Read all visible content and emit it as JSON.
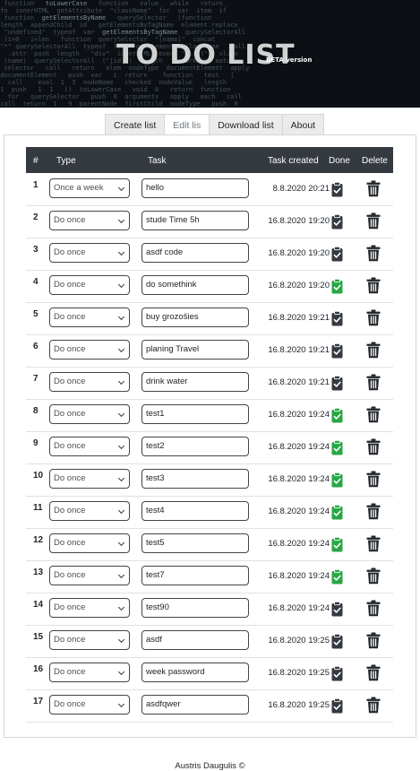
{
  "banner": {
    "title": "TO DO LIST",
    "badge": "BETA version"
  },
  "tabs": [
    {
      "label": "Create list",
      "active": false
    },
    {
      "label": "Edit lis",
      "active": true
    },
    {
      "label": "Download list",
      "active": false
    },
    {
      "label": "About",
      "active": false
    }
  ],
  "table": {
    "headers": {
      "num": "#",
      "type": "Type",
      "task": "Task",
      "created": "Task created",
      "done": "Done",
      "delete": "Delete"
    },
    "rows": [
      {
        "num": "1",
        "type": "Once a week",
        "task": "hello",
        "created": "8.8.2020 20:21",
        "done": false
      },
      {
        "num": "2",
        "type": "Do once",
        "task": "stude Time 5h",
        "created": "16.8.2020 19:20",
        "done": false
      },
      {
        "num": "3",
        "type": "Do once",
        "task": "asdf code",
        "created": "16.8.2020 19:20",
        "done": false
      },
      {
        "num": "4",
        "type": "Do once",
        "task": "do somethink",
        "created": "16.8.2020 19:20",
        "done": true
      },
      {
        "num": "5",
        "type": "Do once",
        "task": "buy grozošies",
        "created": "16.8.2020 19:21",
        "done": false
      },
      {
        "num": "6",
        "type": "Do once",
        "task": "planing Travel",
        "created": "16.8.2020 19:21",
        "done": false
      },
      {
        "num": "7",
        "type": "Do once",
        "task": "drink water",
        "created": "16.8.2020 19:21",
        "done": false
      },
      {
        "num": "8",
        "type": "Do once",
        "task": "test1",
        "created": "16.8.2020 19:24",
        "done": true
      },
      {
        "num": "9",
        "type": "Do once",
        "task": "test2",
        "created": "16.8.2020 19:24",
        "done": true
      },
      {
        "num": "10",
        "type": "Do once",
        "task": "test3",
        "created": "16.8.2020 19:24",
        "done": true
      },
      {
        "num": "11",
        "type": "Do once",
        "task": "test4",
        "created": "16.8.2020 19:24",
        "done": true
      },
      {
        "num": "12",
        "type": "Do once",
        "task": "test5",
        "created": "16.8.2020 19:24",
        "done": true
      },
      {
        "num": "13",
        "type": "Do once",
        "task": "test7",
        "created": "16.8.2020 19:24",
        "done": true
      },
      {
        "num": "14",
        "type": "Do once",
        "task": "test90",
        "created": "16.8.2020 19:24",
        "done": false
      },
      {
        "num": "15",
        "type": "Do once",
        "task": "asdf",
        "created": "16.8.2020 19:25",
        "done": false
      },
      {
        "num": "16",
        "type": "Do once",
        "task": "week password",
        "created": "16.8.2020 19:25",
        "done": false
      },
      {
        "num": "17",
        "type": "Do once",
        "task": "asdfqwer",
        "created": "16.8.2020 19:25",
        "done": false
      }
    ]
  },
  "icons": {
    "done": "clipboard-check-icon",
    "delete": "trash-icon"
  },
  "colors": {
    "done_true": "#28a745",
    "done_false": "#343a40",
    "header_bg": "#343a40",
    "trash": "#212529"
  },
  "footer": {
    "text": "Austris Daugulis ©"
  }
}
